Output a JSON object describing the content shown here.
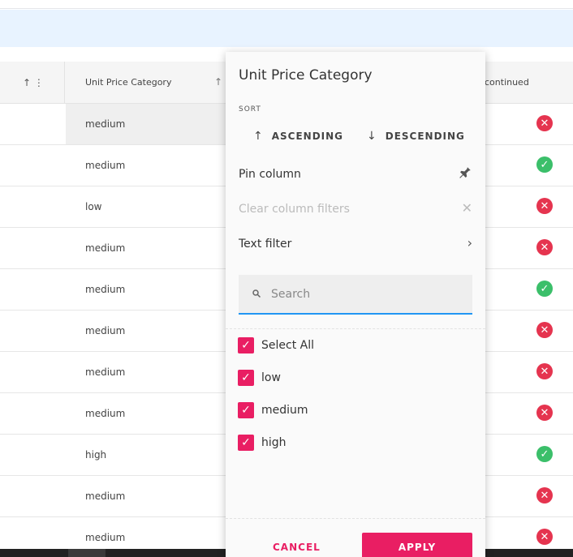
{
  "grid": {
    "header": {
      "first_col_icons": "↑ ⋮",
      "unit_price_label": "Unit Price Category",
      "unit_price_sort_icon": "↑",
      "discontinued_label": "continued"
    },
    "rows": [
      {
        "category": "medium",
        "status": "cross",
        "selected": true
      },
      {
        "category": "medium",
        "status": "check"
      },
      {
        "category": "low",
        "status": "cross"
      },
      {
        "category": "medium",
        "status": "cross"
      },
      {
        "category": "medium",
        "status": "check"
      },
      {
        "category": "medium",
        "status": "cross"
      },
      {
        "category": "medium",
        "status": "cross"
      },
      {
        "category": "medium",
        "status": "cross"
      },
      {
        "category": "high",
        "status": "check"
      },
      {
        "category": "medium",
        "status": "cross"
      },
      {
        "category": "medium",
        "status": "cross"
      }
    ]
  },
  "menu": {
    "title": "Unit Price Category",
    "sort_caption": "SORT",
    "ascending": "ASCENDING",
    "descending": "DESCENDING",
    "pin_column": "Pin column",
    "clear_filters": "Clear column filters",
    "text_filter": "Text filter",
    "search_placeholder": "Search",
    "options": [
      "Select All",
      "low",
      "medium",
      "high"
    ],
    "cancel": "CANCEL",
    "apply": "APPLY"
  },
  "icons": {
    "sort_up": "↑",
    "sort_down": "↓",
    "pin": "pin-icon",
    "close": "close-icon",
    "chevron": "chevron-right-icon",
    "search": "search-icon",
    "check": "check-icon",
    "cross": "cross-icon"
  },
  "colors": {
    "accent": "#e91e63",
    "status_ok": "#3bbf6a",
    "status_no": "#e5344f",
    "search_underline": "#2196f3",
    "banner": "#e8f3ff"
  }
}
